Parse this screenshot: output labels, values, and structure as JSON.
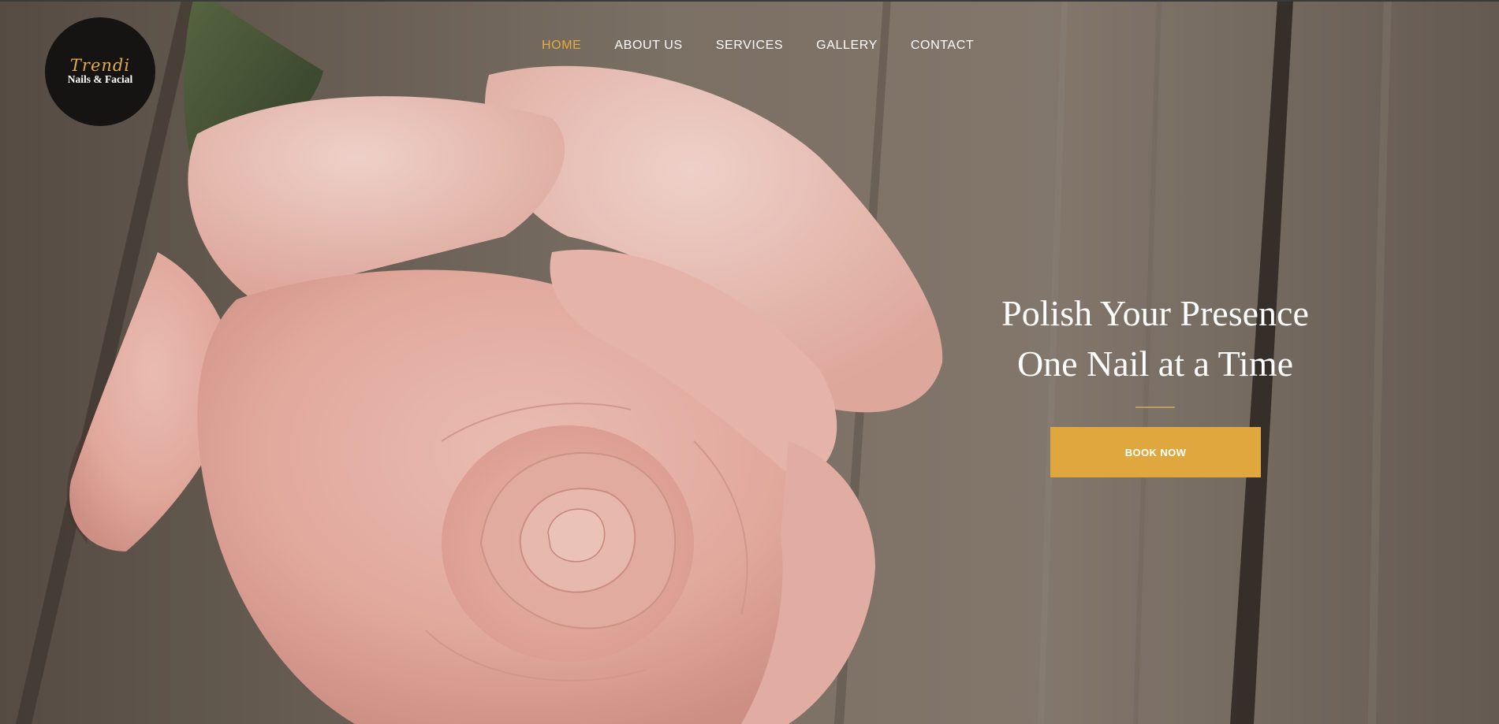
{
  "logo": {
    "script": "Trendi",
    "subtitle": "Nails & Facial"
  },
  "nav": {
    "items": [
      {
        "label": "HOME"
      },
      {
        "label": "ABOUT US"
      },
      {
        "label": "SERVICES"
      },
      {
        "label": "GALLERY"
      },
      {
        "label": "CONTACT"
      }
    ],
    "active": "HOME"
  },
  "hero": {
    "headline_line1": "Polish Your Presence",
    "headline_line2": "One Nail at a Time",
    "cta_label": "BOOK NOW",
    "image": "pink-rose-on-wooden-table"
  },
  "colors": {
    "accent": "#e0a73f",
    "logo_background": "#161412",
    "text": "#ffffff",
    "divider": "#b79b63"
  }
}
